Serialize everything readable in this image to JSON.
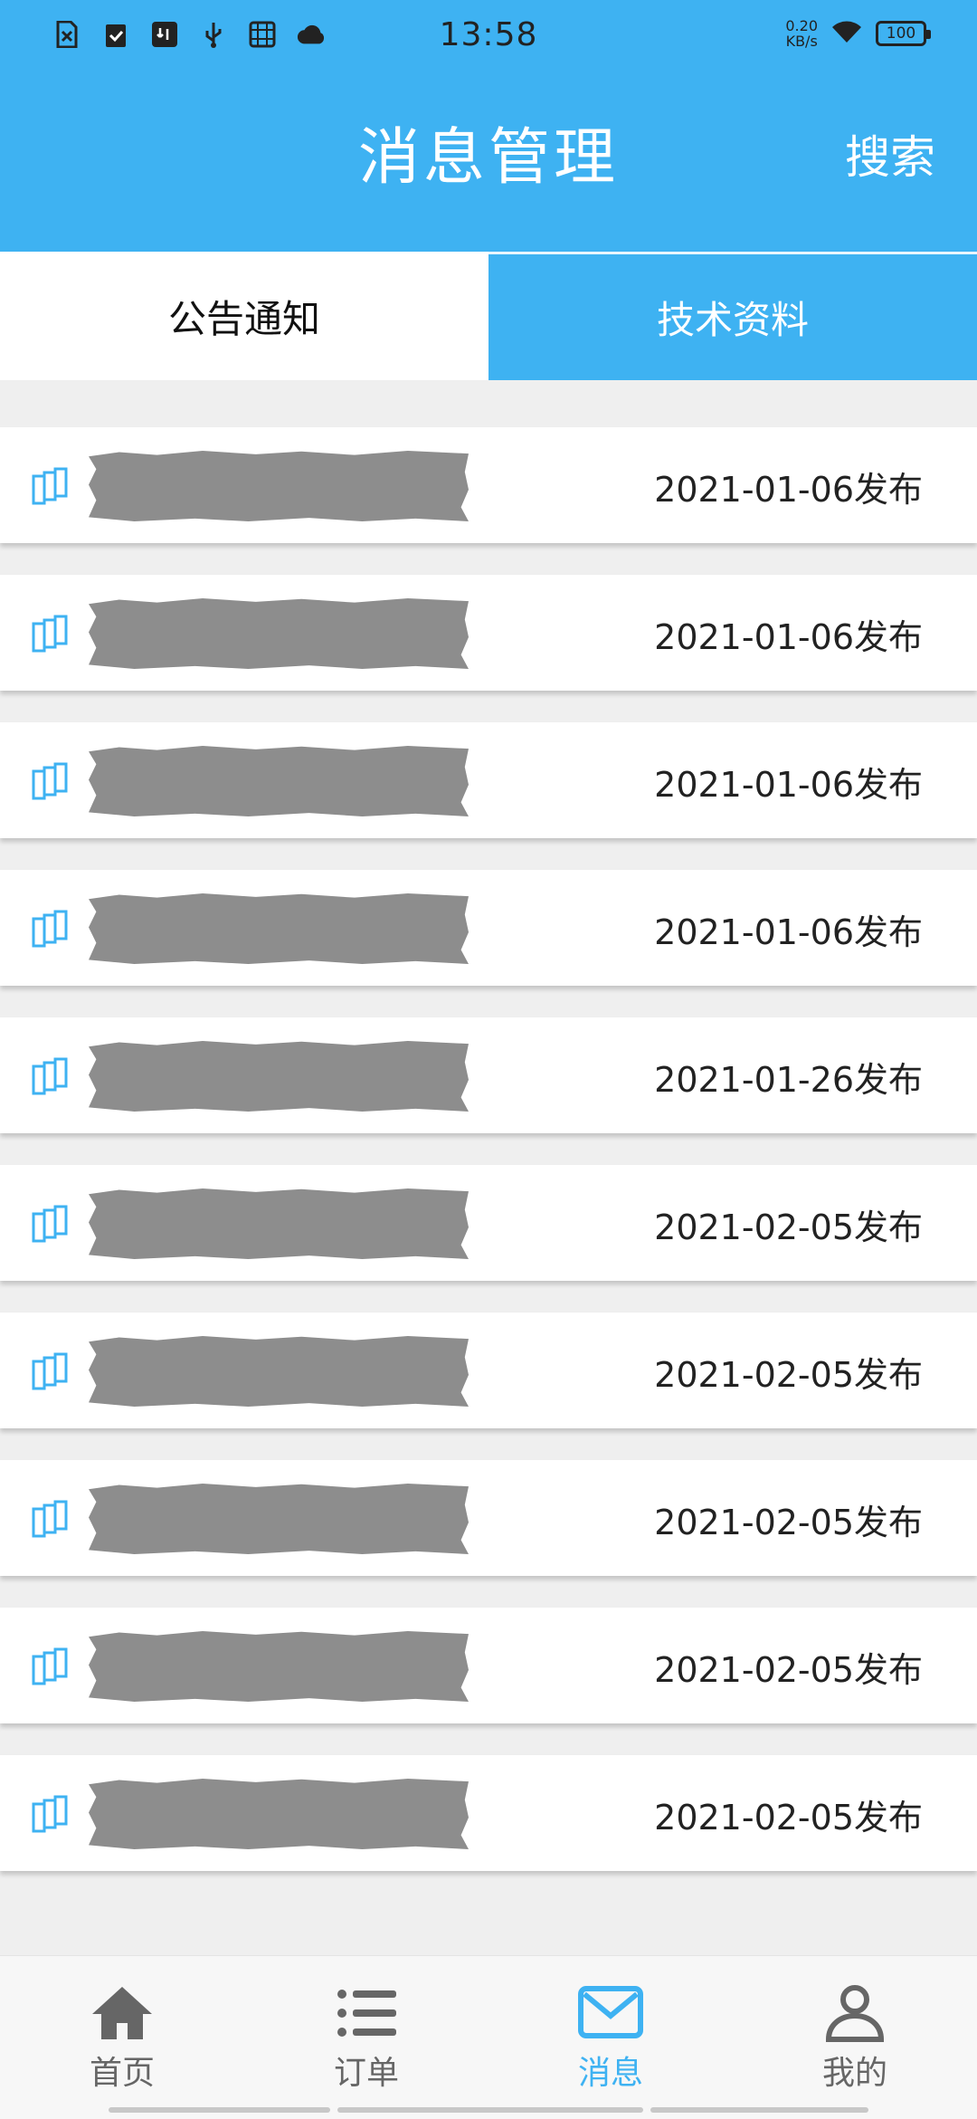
{
  "status_bar": {
    "time": "13:58",
    "speed_value": "0.20",
    "speed_unit": "KB/s",
    "battery": "100"
  },
  "header": {
    "title": "消息管理",
    "search_label": "搜索"
  },
  "tabs": [
    {
      "label": "公告通知",
      "active": false
    },
    {
      "label": "技术资料",
      "active": true
    }
  ],
  "list": {
    "items": [
      {
        "date": "2021-01-06发布"
      },
      {
        "date": "2021-01-06发布"
      },
      {
        "date": "2021-01-06发布"
      },
      {
        "date": "2021-01-06发布"
      },
      {
        "date": "2021-01-26发布"
      },
      {
        "date": "2021-02-05发布"
      },
      {
        "date": "2021-02-05发布"
      },
      {
        "date": "2021-02-05发布"
      },
      {
        "date": "2021-02-05发布"
      },
      {
        "date": "2021-02-05发布"
      }
    ]
  },
  "bottom_nav": {
    "items": [
      {
        "label": "首页",
        "icon": "home-icon"
      },
      {
        "label": "订单",
        "icon": "list-icon"
      },
      {
        "label": "消息",
        "icon": "mail-icon"
      },
      {
        "label": "我的",
        "icon": "person-icon"
      }
    ],
    "active": "消息"
  },
  "colors": {
    "primary": "#3eb2f2",
    "background": "#efefef"
  }
}
